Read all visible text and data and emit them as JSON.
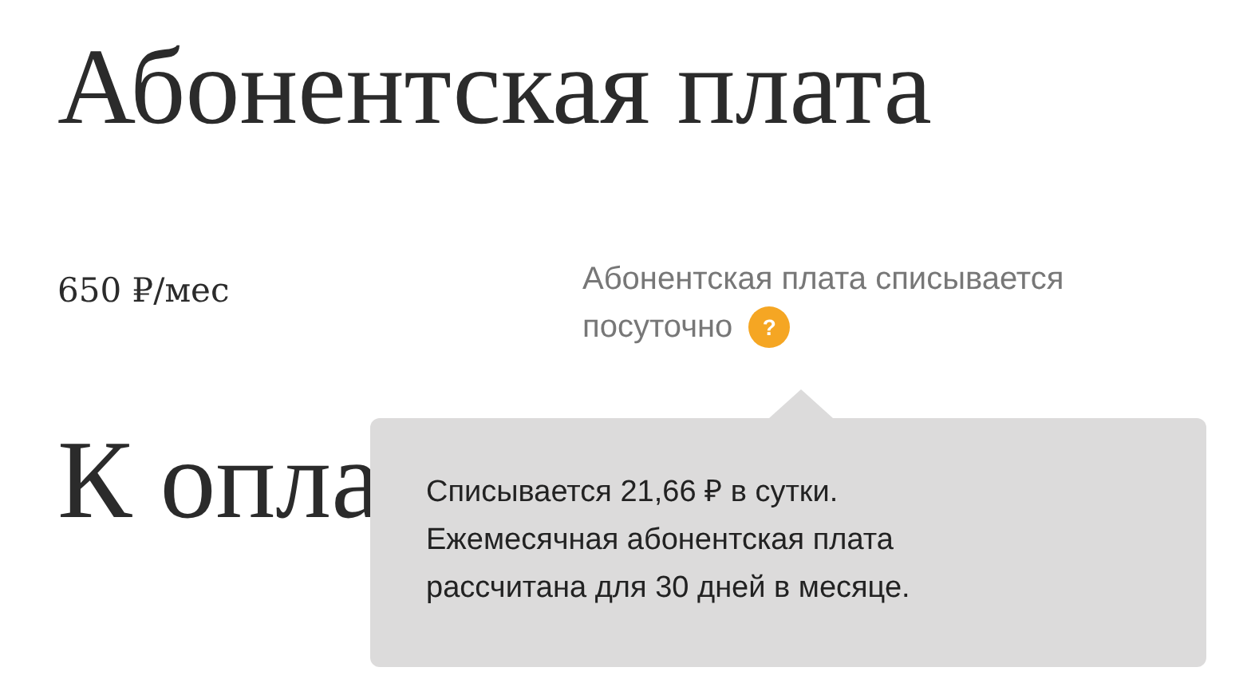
{
  "title": "Абонентская плата",
  "price": "650 ₽/мес",
  "note": {
    "lines": [
      "Абонентская плата списывается",
      "посуточно"
    ],
    "help_icon": "?"
  },
  "tooltip": {
    "lines": [
      "Списывается 21,66 ₽ в сутки.",
      "Ежемесячная абонентская плата",
      "рассчитана для 30 дней в месяце."
    ]
  },
  "section_title": "К опла"
}
